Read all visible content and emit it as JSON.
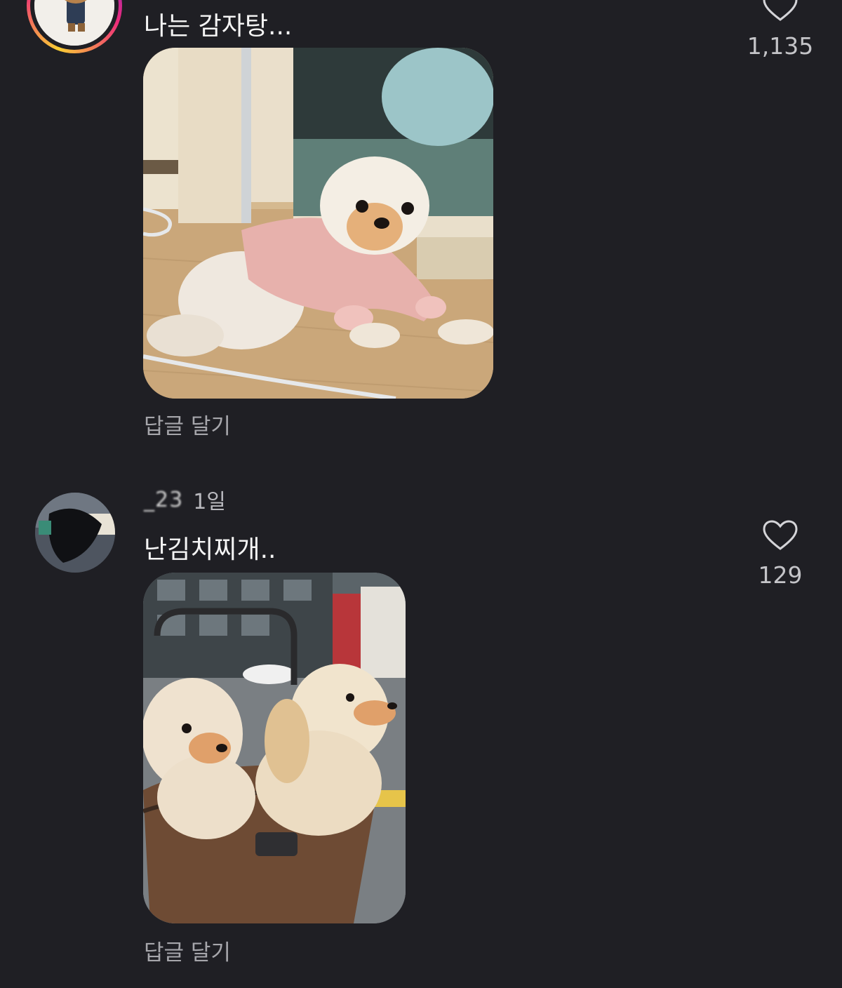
{
  "comments": [
    {
      "text": "나는 감자탕...",
      "reply_label": "답글 달기",
      "like_count": "1,135",
      "avatar_icon": "story-ring-avatar",
      "attachment_icon": "photo-dog-pink-sweater"
    },
    {
      "username": "_23",
      "time": "1일",
      "text": "난김치찌개..",
      "reply_label": "답글 달기",
      "like_count": "129",
      "avatar_icon": "avatar",
      "attachment_icon": "photo-two-dogs-stroller"
    }
  ],
  "colors": {
    "background": "#1f1f24",
    "text": "#f5f5f5",
    "secondary_text": "#a6a6ab",
    "like_count": "#c4c4c8",
    "story_ring": [
      "#f9ce34",
      "#ee2a7b",
      "#6228d7"
    ]
  }
}
